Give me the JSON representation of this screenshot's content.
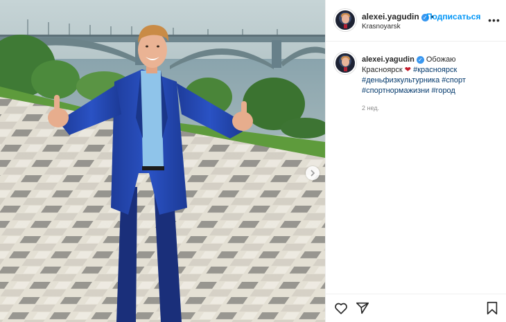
{
  "post": {
    "header": {
      "username": "alexei.yagudin",
      "separator": "•",
      "follow_label": "Подписаться",
      "location": "Krasnoyarsk",
      "more_label": "•••"
    },
    "caption": {
      "username": "alexei.yagudin",
      "text_line1": "Обожаю",
      "text_line2": "Красноярск",
      "emoji": "❤",
      "hashtags": [
        "#красноярск",
        "#деньфизкультурника",
        "#спорт",
        "#спортнормажизни",
        "#город"
      ],
      "age": "2 нед."
    },
    "icons": {
      "verified": "verified-badge-icon",
      "next": "chevron-right-icon",
      "like": "heart-icon",
      "share": "paper-plane-icon",
      "save": "bookmark-icon"
    },
    "colors": {
      "accent": "#0095f6",
      "verified": "#3897f0",
      "hashtag": "#00376b",
      "muted": "#8e8e8e"
    }
  }
}
